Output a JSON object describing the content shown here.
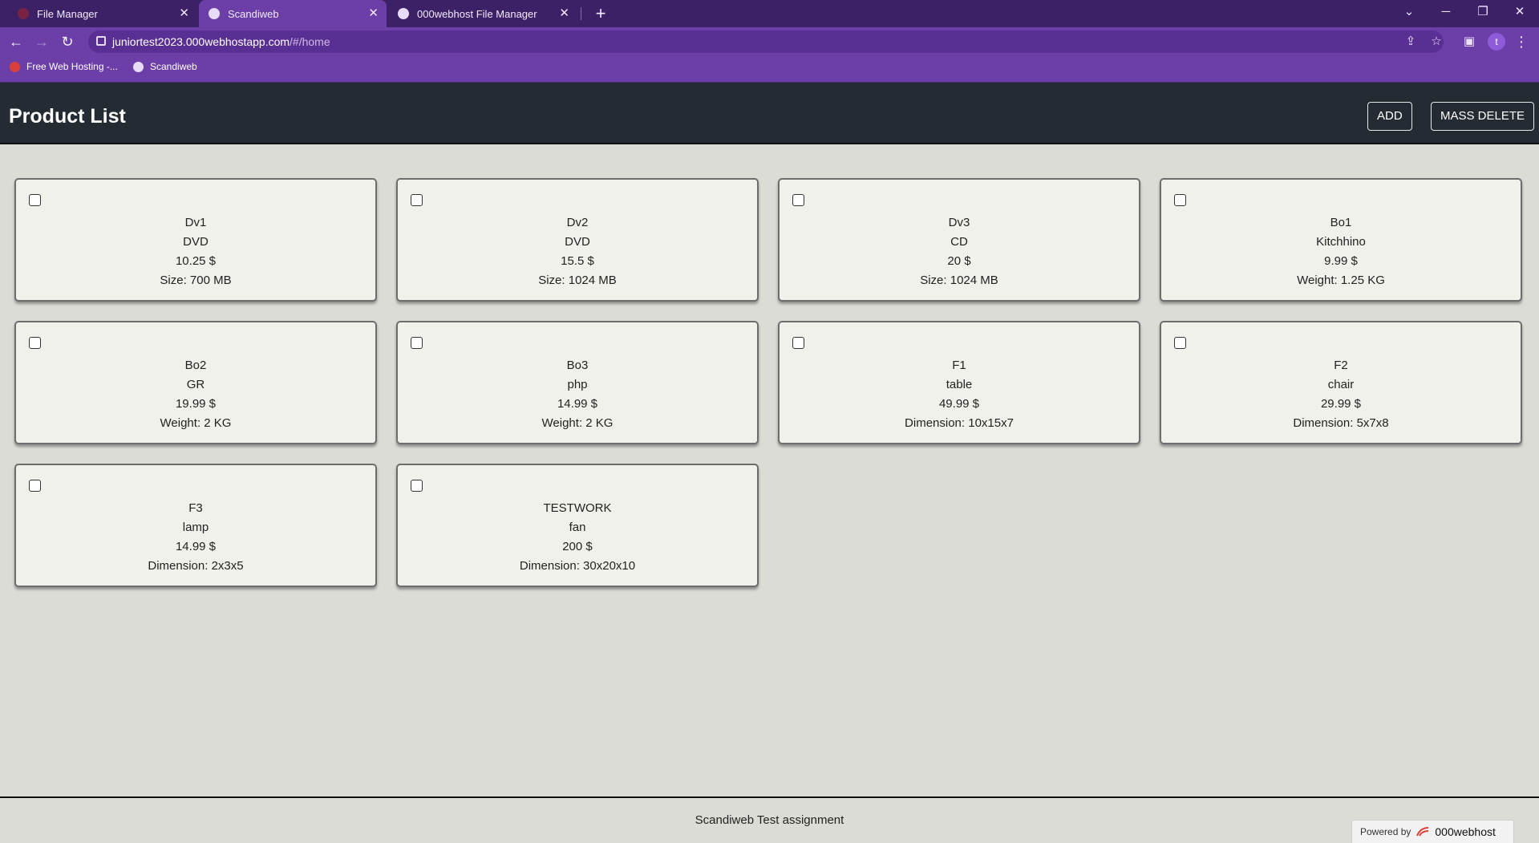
{
  "browser": {
    "tabs": [
      {
        "title": "File Manager",
        "active": false
      },
      {
        "title": "Scandiweb",
        "active": true
      },
      {
        "title": "000webhost File Manager",
        "active": false
      }
    ],
    "url_host": "juniortest2023.000webhostapp.com",
    "url_path": "/#/home",
    "profile_initial": "t",
    "bookmarks": [
      {
        "label": "Free Web Hosting -..."
      },
      {
        "label": "Scandiweb"
      }
    ]
  },
  "header": {
    "title": "Product List",
    "add_label": "ADD",
    "mass_delete_label": "MASS DELETE"
  },
  "products": [
    {
      "sku": "Dv1",
      "name": "DVD",
      "price": "10.25 $",
      "attribute": "Size: 700 MB"
    },
    {
      "sku": "Dv2",
      "name": "DVD",
      "price": "15.5 $",
      "attribute": "Size: 1024 MB"
    },
    {
      "sku": "Dv3",
      "name": "CD",
      "price": "20 $",
      "attribute": "Size: 1024 MB"
    },
    {
      "sku": "Bo1",
      "name": "Kitchhino",
      "price": "9.99 $",
      "attribute": "Weight: 1.25 KG"
    },
    {
      "sku": "Bo2",
      "name": "GR",
      "price": "19.99 $",
      "attribute": "Weight: 2 KG"
    },
    {
      "sku": "Bo3",
      "name": "php",
      "price": "14.99 $",
      "attribute": "Weight: 2 KG"
    },
    {
      "sku": "F1",
      "name": "table",
      "price": "49.99 $",
      "attribute": "Dimension: 10x15x7"
    },
    {
      "sku": "F2",
      "name": "chair",
      "price": "29.99 $",
      "attribute": "Dimension: 5x7x8"
    },
    {
      "sku": "F3",
      "name": "lamp",
      "price": "14.99 $",
      "attribute": "Dimension: 2x3x5"
    },
    {
      "sku": "TESTWORK",
      "name": "fan",
      "price": "200 $",
      "attribute": "Dimension: 30x20x10"
    }
  ],
  "footer": {
    "text": "Scandiweb Test assignment",
    "powered_by": "Powered by",
    "powered_brand": "000webhost"
  },
  "colors": {
    "tabbar": "#3d2166",
    "toolbar": "#6c3fa8",
    "header": "#252b33",
    "page_bg": "#dcdcd7",
    "card_bg": "#f1f1ec"
  }
}
